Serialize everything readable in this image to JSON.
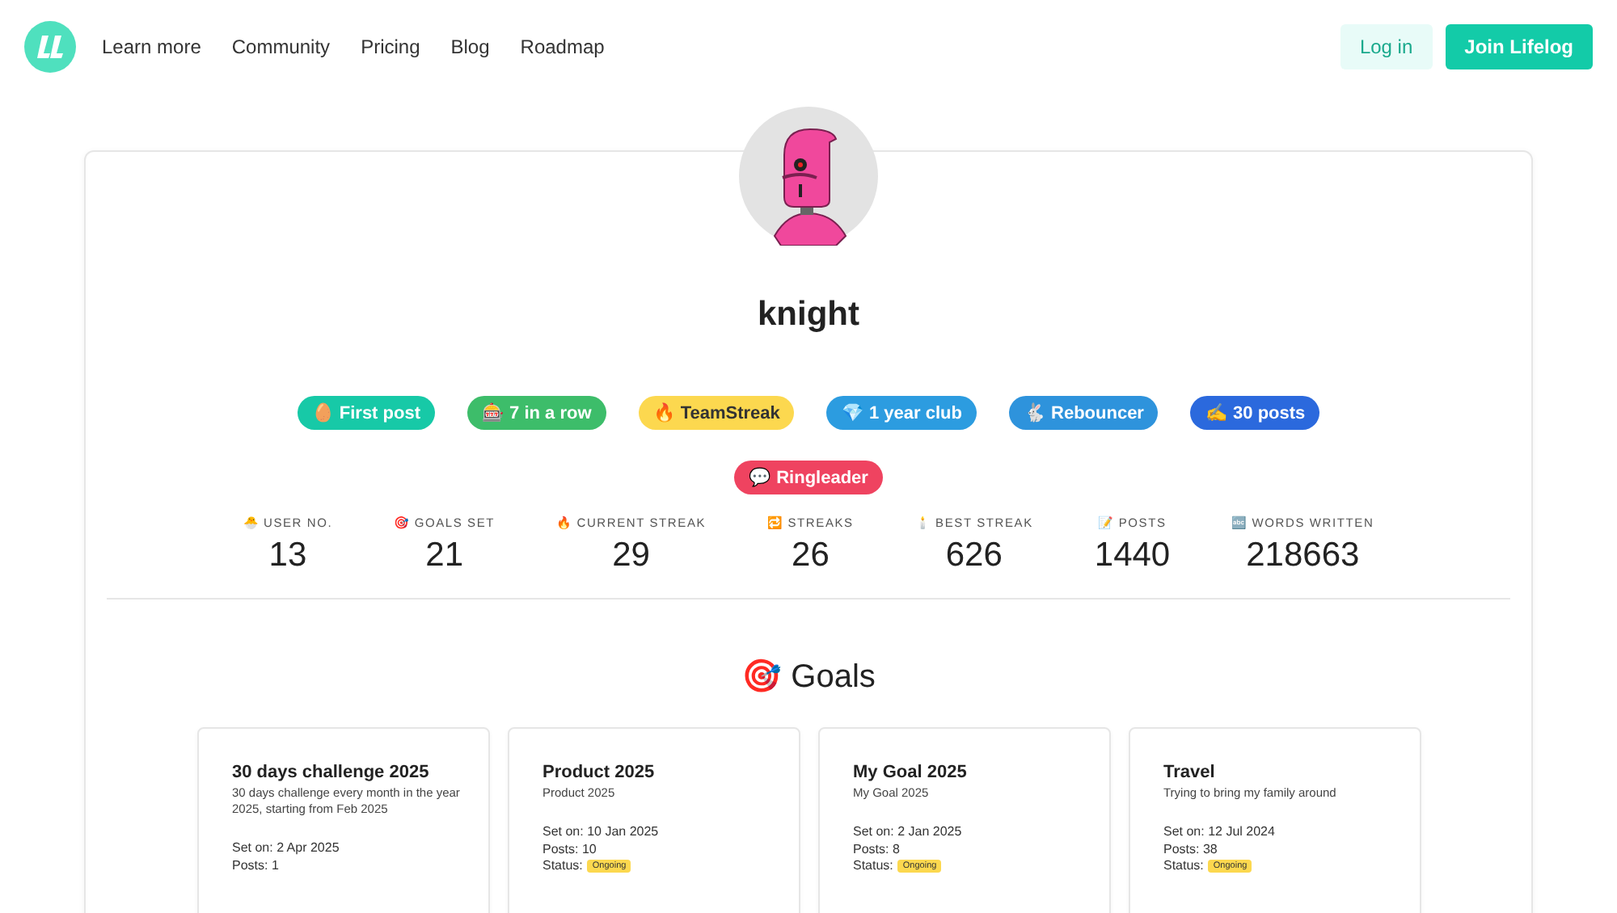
{
  "nav": {
    "links": [
      "Learn more",
      "Community",
      "Pricing",
      "Blog",
      "Roadmap"
    ],
    "login": "Log in",
    "join": "Join Lifelog"
  },
  "profile": {
    "username": "knight",
    "badges": [
      {
        "label": "🥚 First post",
        "color": "#17c9a7"
      },
      {
        "label": "🎰 7 in a row",
        "color": "#3dbd6a"
      },
      {
        "label": "🔥 TeamStreak",
        "color": "#fcd84f"
      },
      {
        "label": "💎 1 year club",
        "color": "#2c9ce0"
      },
      {
        "label": "🐇 Rebouncer",
        "color": "#2e93dc"
      },
      {
        "label": "✍️ 30 posts",
        "color": "#2b69dd"
      },
      {
        "label": "💬 Ringleader",
        "color": "#ef4360"
      }
    ],
    "stats": [
      {
        "label": "🐣 USER NO.",
        "value": "13"
      },
      {
        "label": "🎯 GOALS SET",
        "value": "21"
      },
      {
        "label": "🔥 CURRENT STREAK",
        "value": "29"
      },
      {
        "label": "🔁 STREAKS",
        "value": "26"
      },
      {
        "label": "🕯️ BEST STREAK",
        "value": "626"
      },
      {
        "label": "📝 POSTS",
        "value": "1440"
      },
      {
        "label": "🔤 WORDS WRITTEN",
        "value": "218663"
      }
    ]
  },
  "goals": {
    "heading": "🎯 Goals",
    "cards": [
      {
        "title": "30 days challenge 2025",
        "description": "30 days challenge every month in the year 2025, starting from Feb 2025",
        "set_on": "Set on: 2 Apr 2025",
        "posts": "Posts: 1"
      },
      {
        "title": "Product 2025",
        "description": "Product 2025",
        "set_on": "Set on: 10 Jan 2025",
        "posts": "Posts: 10",
        "status_label": "Status:",
        "status": "Ongoing"
      },
      {
        "title": "My Goal 2025",
        "description": "My Goal 2025",
        "set_on": "Set on: 2 Jan 2025",
        "posts": "Posts: 8",
        "status_label": "Status:",
        "status": "Ongoing"
      },
      {
        "title": "Travel",
        "description": "Trying to bring my family around",
        "set_on": "Set on: 12 Jul 2024",
        "posts": "Posts: 38",
        "status_label": "Status:",
        "status": "Ongoing"
      }
    ]
  }
}
